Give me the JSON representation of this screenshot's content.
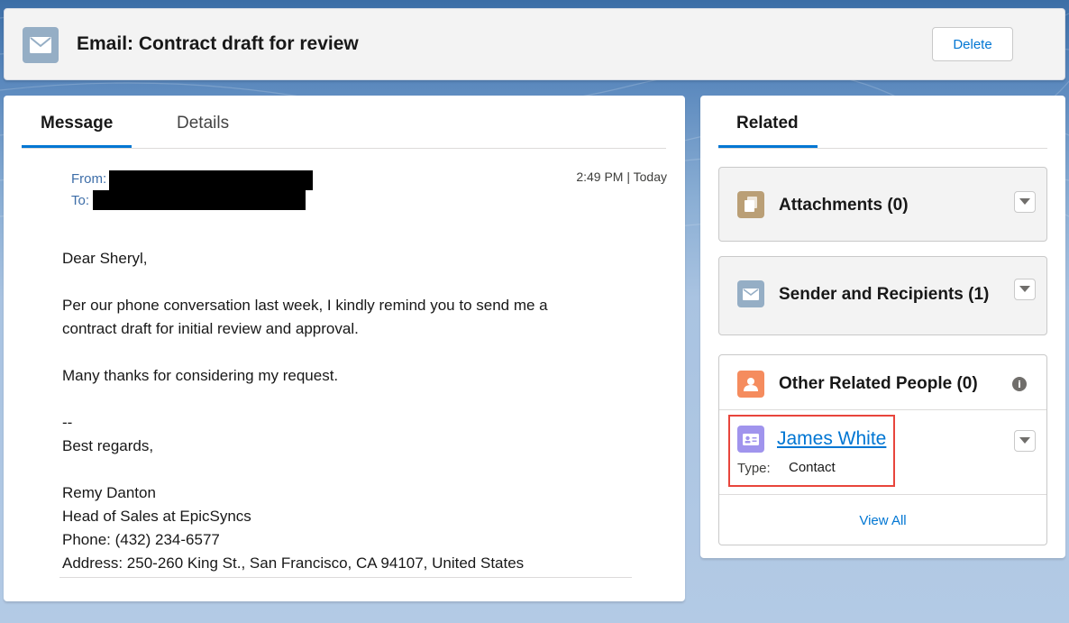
{
  "header": {
    "title": "Email: Contract draft for review",
    "delete_label": "Delete",
    "icon": "email-icon"
  },
  "message_card": {
    "tabs": [
      {
        "label": "Message",
        "active": true
      },
      {
        "label": "Details",
        "active": false
      }
    ],
    "from_label": "From:",
    "to_label": "To:",
    "timestamp": "2:49 PM | Today",
    "body_lines": [
      "Dear Sheryl,",
      "",
      "Per our phone conversation last week, I kindly remind you to send me a",
      "contract draft for initial review and approval.",
      "",
      "Many thanks for considering my request.",
      "",
      "--",
      "Best regards,",
      "",
      "Remy Danton",
      "Head of Sales at EpicSyncs",
      "Phone: (432) 234-6577",
      "Address: 250-260 King St., San Francisco, CA 94107, United States"
    ]
  },
  "related_card": {
    "tab_label": "Related",
    "attachments_title": "Attachments (0)",
    "senders_title": "Sender and Recipients (1)",
    "people_title": "Other Related People (0)",
    "person": {
      "name": "James White",
      "type_label": "Type:",
      "type_value": "Contact"
    },
    "view_all": "View All"
  },
  "colors": {
    "accent": "#0176d3",
    "email_icon_bg": "#95aec5",
    "attachments_icon_bg": "#ba9f76",
    "person_icon_bg": "#f58c5e",
    "contact_icon_bg": "#a094ed",
    "highlight": "#e8453c"
  }
}
